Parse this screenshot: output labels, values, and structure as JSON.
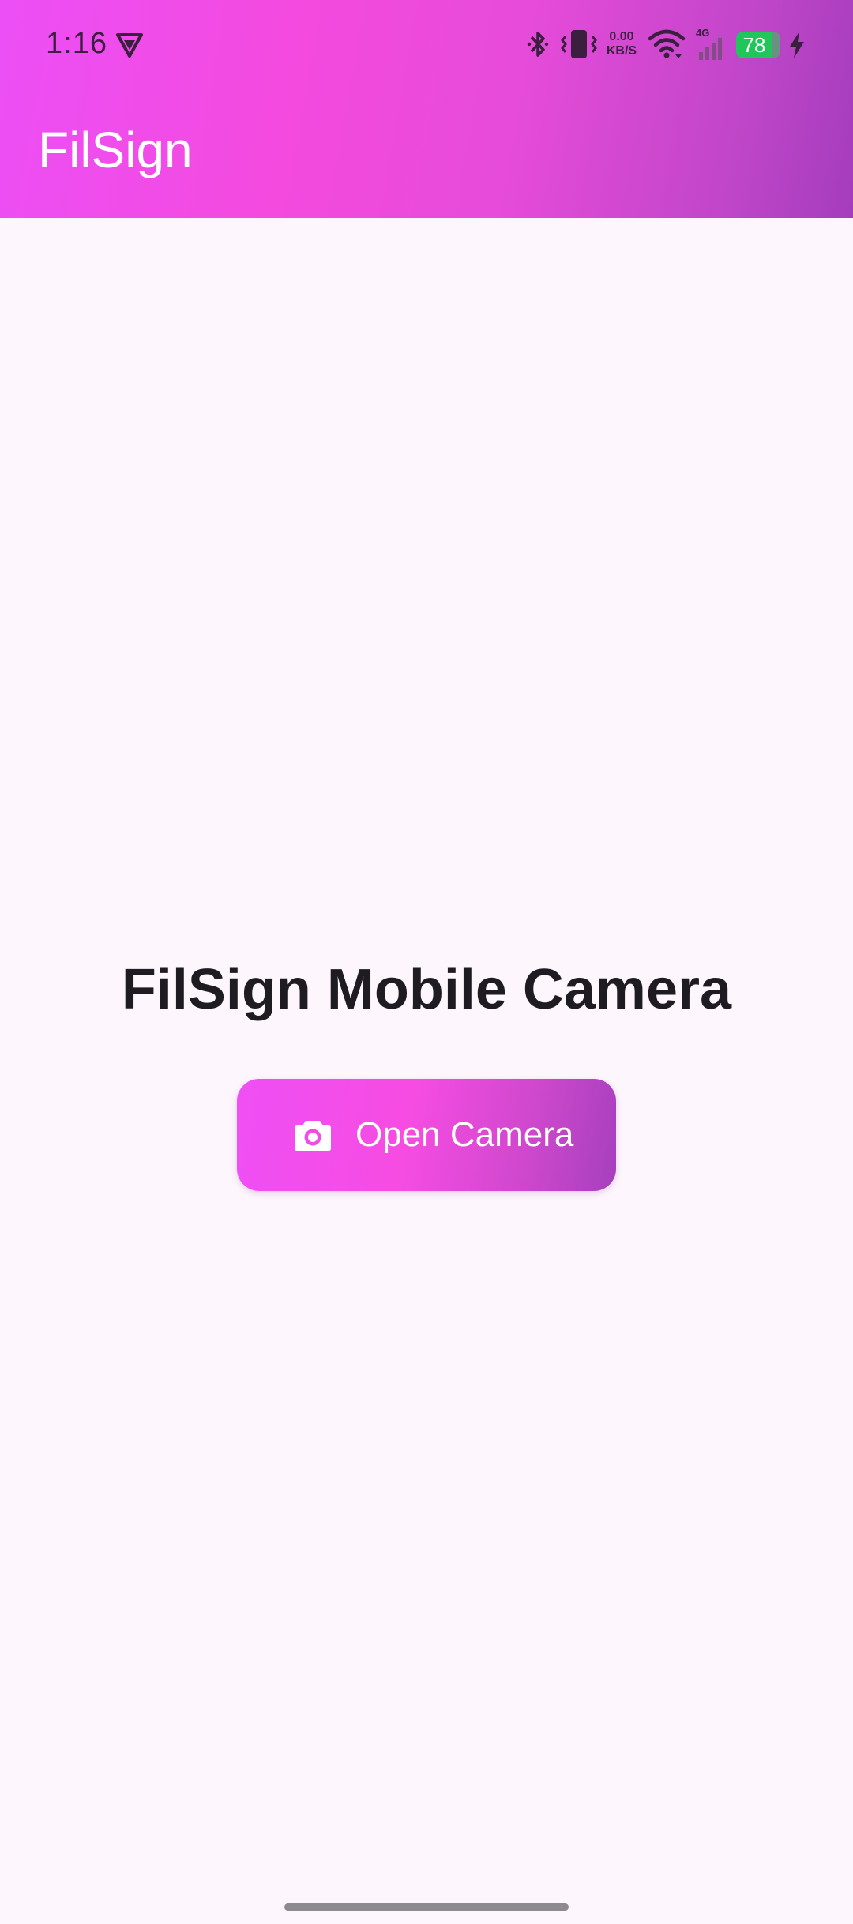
{
  "status_bar": {
    "time": "1:16",
    "net_speed_value": "0.00",
    "net_speed_unit": "KB/S",
    "signal_label": "4G",
    "battery_level": "78",
    "icons": [
      "vpn-shield-icon",
      "bluetooth-icon",
      "vibrate-icon",
      "wifi-icon",
      "cellular-signal-icon",
      "battery-icon",
      "charging-icon"
    ]
  },
  "app_bar": {
    "title": "FilSign"
  },
  "main": {
    "heading": "FilSign Mobile Camera",
    "open_camera_button": {
      "label": "Open Camera",
      "icon": "camera-icon"
    }
  },
  "colors": {
    "gradient_start": "#EC4FF6",
    "gradient_mid": "#F44ADE",
    "gradient_end": "#A43DBC",
    "background": "#FDF6FD",
    "heading_text": "#1E1B22",
    "battery_green": "#20C65A"
  }
}
